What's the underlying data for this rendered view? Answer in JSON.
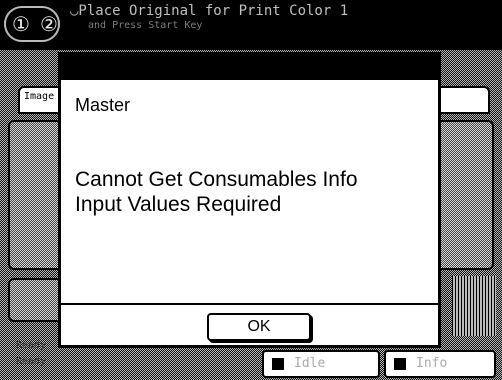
{
  "header": {
    "set_count": "① ②",
    "message_line1": "◡Place Original for Print Color 1",
    "message_line2": "and Press Start Key"
  },
  "background": {
    "tab_image_label": "Image",
    "left_label_top": "Ready",
    "left_label_bottom": "Ready",
    "status_idle": "Idle",
    "status_info": "Info"
  },
  "dialog": {
    "title": "Master",
    "message": "Cannot Get Consumables Info\nInput Values Required",
    "ok_label": "OK"
  }
}
